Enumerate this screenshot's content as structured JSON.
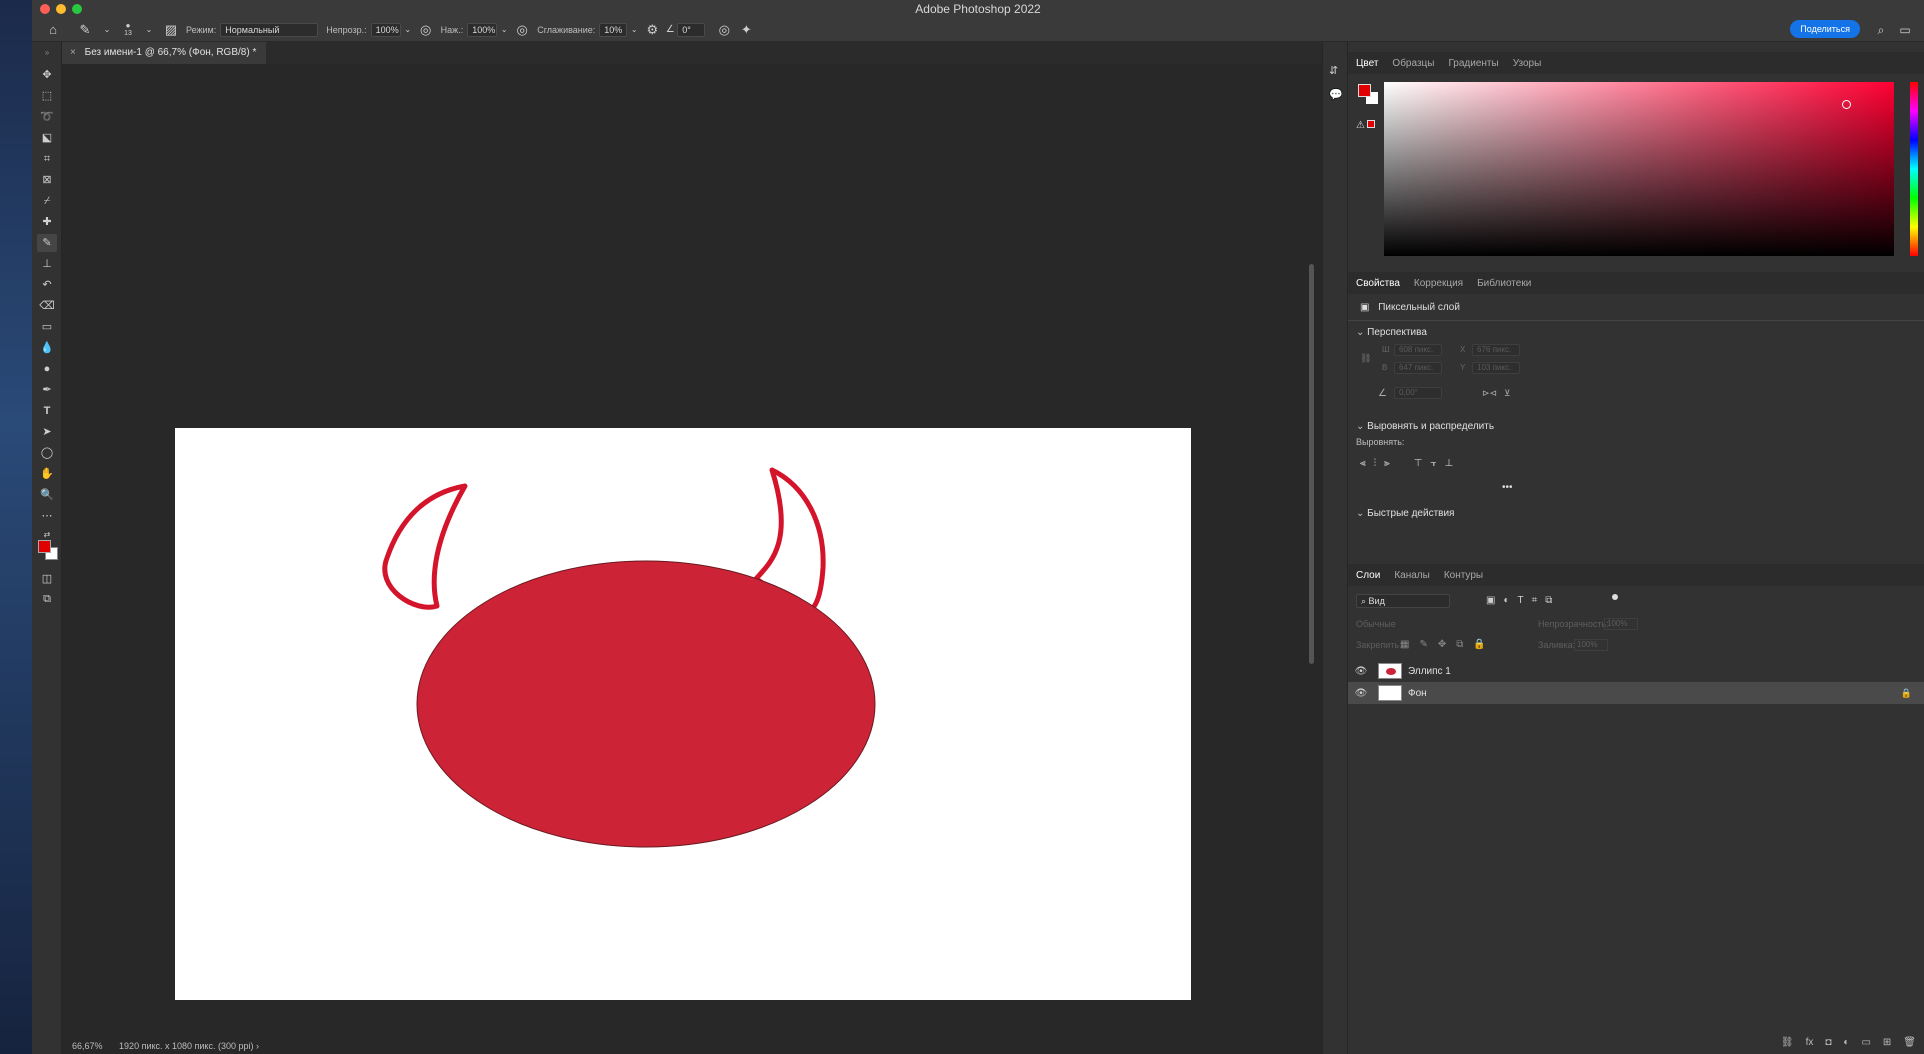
{
  "window": {
    "title": "Adobe Photoshop 2022"
  },
  "options_bar": {
    "brush_size": "13",
    "mode_label": "Режим:",
    "mode_value": "Нормальный",
    "opacity_label": "Непрозр.:",
    "opacity_value": "100%",
    "pressure_label": "Наж.:",
    "pressure_value": "100%",
    "smoothing_label": "Сглаживание:",
    "smoothing_value": "10%",
    "angle_value": "0°",
    "share_label": "Поделиться"
  },
  "document": {
    "tab_label": "Без имени-1 @ 66,7% (Фон, RGB/8) *",
    "status_zoom": "66,67%",
    "status_info": "1920 пикс. x 1080 пикс. (300 ppi)  ›"
  },
  "colors": {
    "foreground": "#e00000",
    "background": "#ffffff",
    "shape_fill": "#cc2336",
    "horn_stroke": "#d4142a"
  },
  "color_panel": {
    "tabs": [
      "Цвет",
      "Образцы",
      "Градиенты",
      "Узоры"
    ],
    "active_tab": "Цвет",
    "hue": "#ff0033"
  },
  "properties_panel": {
    "tabs": [
      "Свойства",
      "Коррекция",
      "Библиотеки"
    ],
    "active_tab": "Свойства",
    "layer_type": "Пиксельный слой",
    "perspective_title": "Перспектива",
    "fields": {
      "w_label": "Ш",
      "w_value": "608 пикс.",
      "x_label": "X",
      "x_value": "676 пикс.",
      "h_label": "В",
      "h_value": "647 пикс.",
      "y_label": "Y",
      "y_value": "103 пикс.",
      "angle_value": "0,00°"
    },
    "align_title": "Выровнять и распределить",
    "align_label": "Выровнять:",
    "more": "•••",
    "quick_actions_title": "Быстрые действия"
  },
  "layers_panel": {
    "tabs": [
      "Слои",
      "Каналы",
      "Контуры"
    ],
    "active_tab": "Слои",
    "filter_value": "Вид",
    "blend_mode": "Обычные",
    "opacity_label": "Непрозрачность:",
    "opacity_value": "100%",
    "lock_label": "Закрепить:",
    "fill_label": "Заливка:",
    "fill_value": "100%",
    "layers": [
      {
        "name": "Эллипс 1",
        "visible": true,
        "locked": false,
        "selected": false
      },
      {
        "name": "Фон",
        "visible": true,
        "locked": true,
        "selected": true
      }
    ]
  }
}
